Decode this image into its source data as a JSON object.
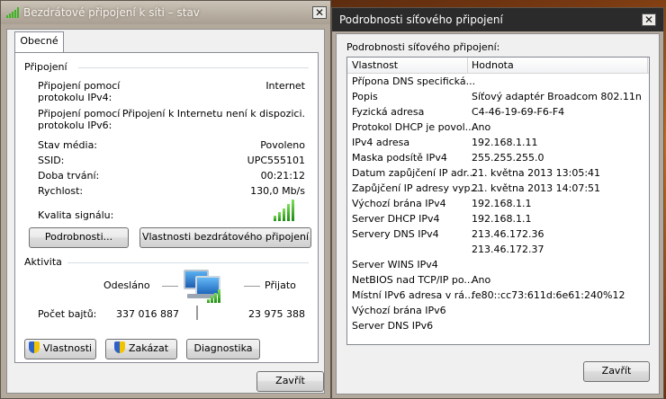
{
  "left_window": {
    "title": "Bezdrátové připojení k síti – stav",
    "close": "✕",
    "tab": "Obecné",
    "connection": {
      "group": "Připojení",
      "rows": [
        {
          "label_line1": "Připojení pomocí",
          "label_line2": "protokolu IPv4:",
          "value": "Internet"
        },
        {
          "label_line1": "Připojení pomocí",
          "label_line2": "protokolu IPv6:",
          "value": "Připojení k Internetu není k dispozici."
        }
      ],
      "media_state_label": "Stav média:",
      "media_state_value": "Povoleno",
      "ssid_label": "SSID:",
      "ssid_value": "UPC555101",
      "duration_label": "Doba trvání:",
      "duration_value": "00:21:12",
      "speed_label": "Rychlost:",
      "speed_value": "130,0 Mb/s",
      "signal_label": "Kvalita signálu:",
      "signal_bars_lit": 5,
      "details_button": "Podrobnosti...",
      "wireless_props_button": "Vlastnosti bezdrátového připojení"
    },
    "activity": {
      "group": "Aktivita",
      "sent_label": "Odesláno",
      "received_label": "Přijato",
      "bytes_label": "Počet bajtů:",
      "bytes_sent": "337 016 887",
      "bytes_received": "23 975 388"
    },
    "buttons": {
      "properties": "Vlastnosti",
      "disable": "Zakázat",
      "diagnose": "Diagnostika",
      "close": "Zavřít"
    },
    "signal_color": "#3cb521"
  },
  "right_window": {
    "title": "Podrobnosti síťového připojení",
    "close": "✕",
    "heading": "Podrobnosti síťového připojení:",
    "columns": [
      "Vlastnost",
      "Hodnota"
    ],
    "rows": [
      [
        "Přípona DNS specifická...",
        ""
      ],
      [
        "Popis",
        "Síťový adaptér Broadcom 802.11n"
      ],
      [
        "Fyzická adresa",
        "C4-46-19-69-F6-F4"
      ],
      [
        "Protokol DHCP je povol...",
        "Ano"
      ],
      [
        "IPv4 adresa",
        "192.168.1.11"
      ],
      [
        "Maska podsítě IPv4",
        "255.255.255.0"
      ],
      [
        "Datum zapůjčení IP adr...",
        "21. května 2013 13:05:41"
      ],
      [
        "Zapůjčení IP adresy vyp...",
        "21. května 2013 14:07:51"
      ],
      [
        "Výchozí brána IPv4",
        "192.168.1.1"
      ],
      [
        "Server DHCP IPv4",
        "192.168.1.1"
      ],
      [
        "Servery DNS IPv4",
        "213.46.172.36"
      ],
      [
        "",
        "213.46.172.37"
      ],
      [
        "Server WINS IPv4",
        ""
      ],
      [
        "NetBIOS nad TCP/IP po...",
        "Ano"
      ],
      [
        "Místní IPv6 adresa v rá...",
        "fe80::cc73:611d:6e61:240%12"
      ],
      [
        "Výchozí brána IPv6",
        ""
      ],
      [
        "Server DNS IPv6",
        ""
      ]
    ],
    "close_button": "Zavřít"
  }
}
